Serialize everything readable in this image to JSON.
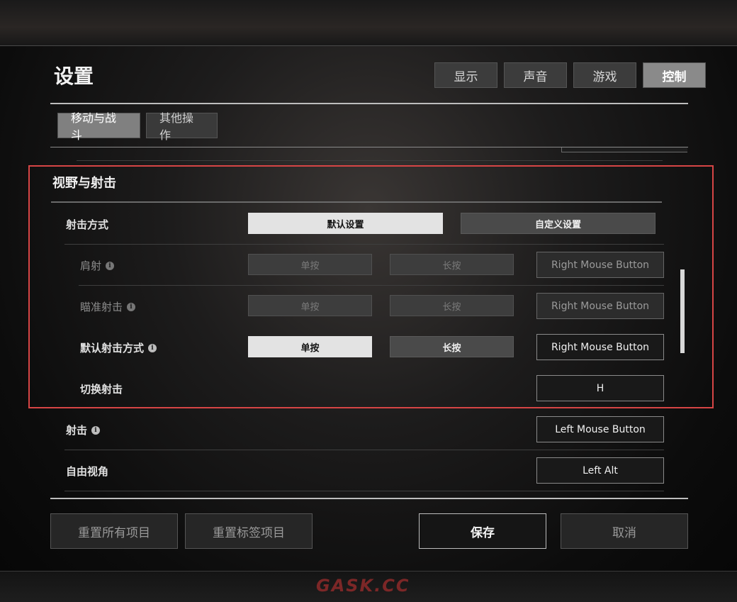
{
  "title": "设置",
  "top_tabs": [
    {
      "label": "显示",
      "active": false
    },
    {
      "label": "声音",
      "active": false
    },
    {
      "label": "游戏",
      "active": false
    },
    {
      "label": "控制",
      "active": true
    }
  ],
  "sub_tabs": [
    {
      "label": "移动与战斗",
      "active": true
    },
    {
      "label": "其他操作",
      "active": false
    }
  ],
  "section": {
    "title": "视野与射击",
    "shoot_mode": {
      "label": "射击方式",
      "options": [
        "默认设置",
        "自定义设置"
      ],
      "selected": "默认设置"
    },
    "rows": [
      {
        "label": "肩射",
        "options": [
          "单按",
          "长按"
        ],
        "key": "Right Mouse Button",
        "disabled": true
      },
      {
        "label": "瞄准射击",
        "options": [
          "单按",
          "长按"
        ],
        "key": "Right Mouse Button",
        "disabled": true
      },
      {
        "label": "默认射击方式",
        "options": [
          "单按",
          "长按"
        ],
        "selected": "单按",
        "key": "Right Mouse Button",
        "disabled": false
      },
      {
        "label": "切换射击",
        "key": "H"
      }
    ]
  },
  "extra_rows": [
    {
      "label": "射击",
      "key": "Left Mouse Button"
    },
    {
      "label": "自由视角",
      "key": "Left Alt"
    }
  ],
  "footer": {
    "reset_all": "重置所有项目",
    "reset_tab": "重置标签项目",
    "save": "保存",
    "cancel": "取消"
  },
  "watermark": "GASK.CC",
  "colors": {
    "highlight": "#d64545",
    "active_tab": "#8a8a8a"
  }
}
